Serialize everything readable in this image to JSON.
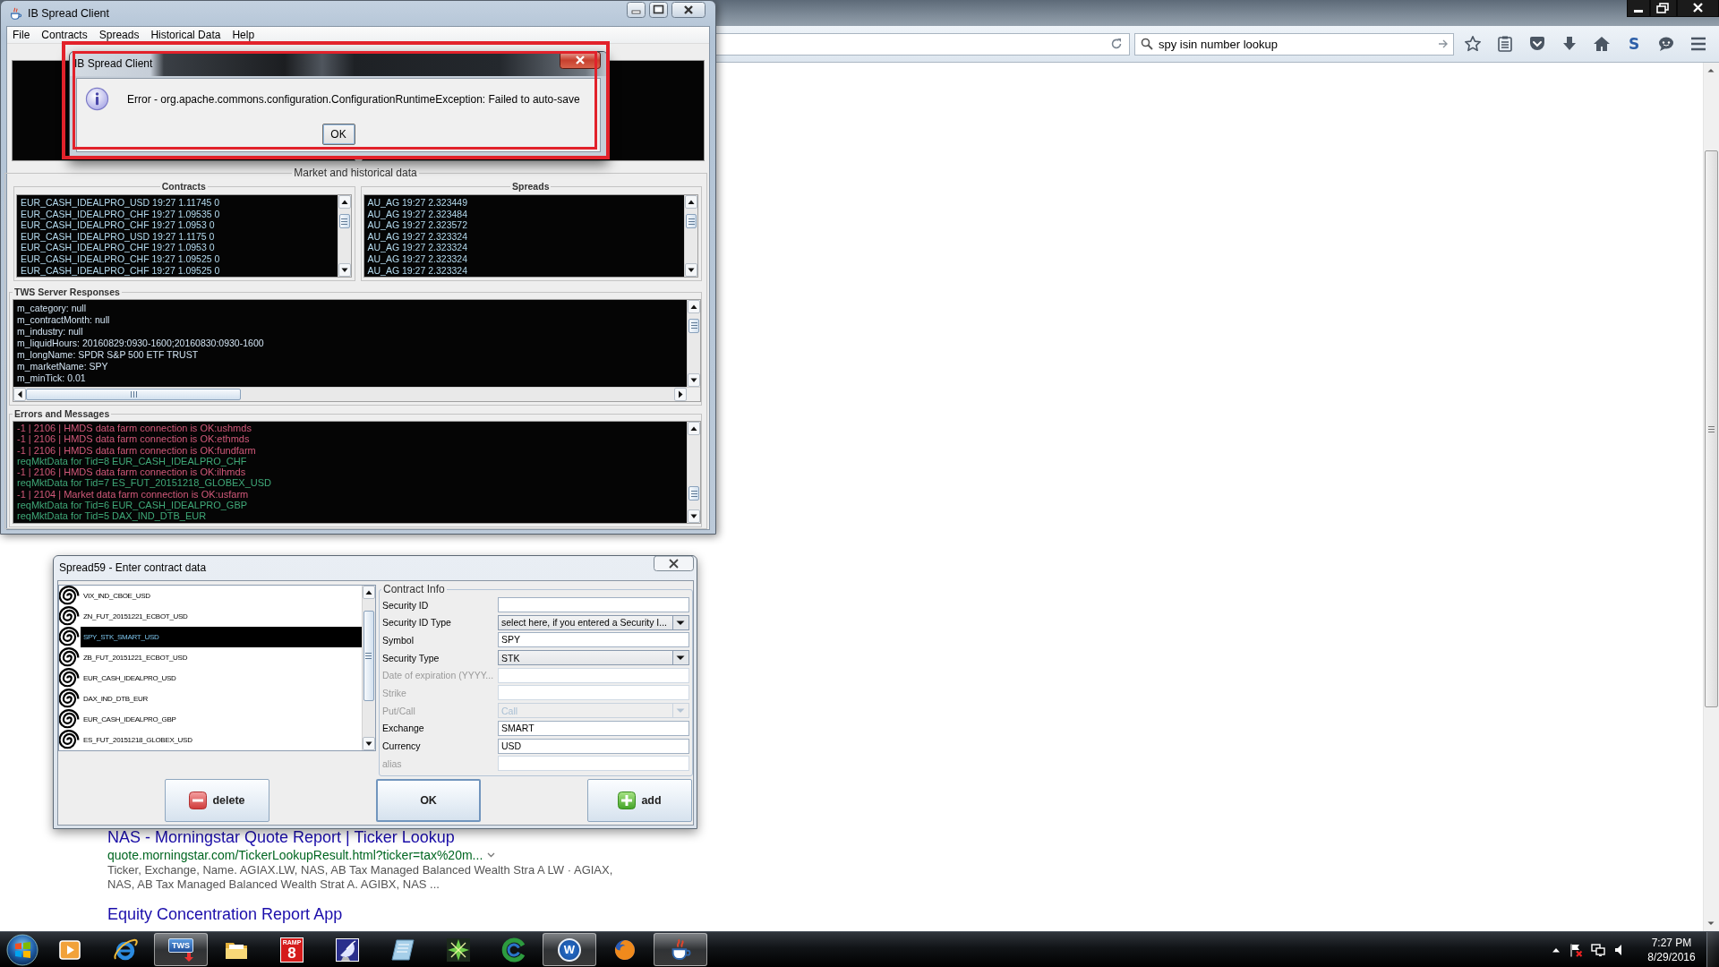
{
  "browser": {
    "search_field": {
      "value": "spy isin number lookup"
    },
    "logo_button": "S",
    "results": [
      {
        "title": "NAS - Morningstar Quote Report | Ticker Lookup",
        "url": "quote.morningstar.com/TickerLookupResult.html?ticker=tax%20m...",
        "snippet": "Ticker, Exchange, Name. AGIAX.LW, NAS, AB Tax Managed Balanced Wealth Stra A LW · AGIAX, NAS, AB Tax Managed Balanced Wealth Strat A. AGIBX, NAS ..."
      },
      {
        "title": "Equity Concentration Report App"
      }
    ]
  },
  "main_window": {
    "title": "IB Spread Client",
    "menu": [
      "File",
      "Contracts",
      "Spreads",
      "Historical Data",
      "Help"
    ],
    "market_panel": {
      "title": "Market and historical data",
      "contracts": {
        "title": "Contracts",
        "lines": [
          "EUR_CASH_IDEALPRO_USD 19:27 1.11745 0",
          "EUR_CASH_IDEALPRO_CHF 19:27 1.09535 0",
          "EUR_CASH_IDEALPRO_CHF 19:27 1.0953 0",
          "EUR_CASH_IDEALPRO_USD 19:27 1.1175 0",
          "EUR_CASH_IDEALPRO_CHF 19:27 1.0953 0",
          "EUR_CASH_IDEALPRO_CHF 19:27 1.09525 0",
          "EUR_CASH_IDEALPRO_CHF 19:27 1.09525 0"
        ]
      },
      "spreads": {
        "title": "Spreads",
        "lines": [
          "AU_AG 19:27 2.323449",
          "AU_AG 19:27 2.323484",
          "AU_AG 19:27 2.323572",
          "AU_AG 19:27 2.323324",
          "AU_AG 19:27 2.323324",
          "AU_AG 19:27 2.323324",
          "AU_AG 19:27 2.323324"
        ]
      },
      "tws_responses": {
        "title": "TWS Server Responses",
        "lines": [
          "m_category: null",
          "m_contractMonth: null",
          "m_industry: null",
          "m_liquidHours: 20160829:0930-1600;20160830:0930-1600",
          "m_longName: SPDR S&P 500 ETF TRUST",
          "m_marketName: SPY",
          "m_minTick: 0.01"
        ]
      },
      "errors_and_messages": {
        "title": "Errors and Messages",
        "lines": [
          {
            "text": "-1 | 2106 | HMDS data farm connection is OK:ushmds",
            "color": "#d2597a"
          },
          {
            "text": "-1 | 2106 | HMDS data farm connection is OK:ethmds",
            "color": "#d2597a"
          },
          {
            "text": "-1 | 2106 | HMDS data farm connection is OK:fundfarm",
            "color": "#d2597a"
          },
          {
            "text": "reqMktData for Tid=8 EUR_CASH_IDEALPRO_CHF",
            "color": "#3fa878"
          },
          {
            "text": "-1 | 2106 | HMDS data farm connection is OK:ilhmds",
            "color": "#d2597a"
          },
          {
            "text": "reqMktData for Tid=7 ES_FUT_20151218_GLOBEX_USD",
            "color": "#3fa878"
          },
          {
            "text": "-1 | 2104 | Market data farm connection is OK:usfarm",
            "color": "#d2597a"
          },
          {
            "text": "reqMktData for Tid=6 EUR_CASH_IDEALPRO_GBP",
            "color": "#3fa878"
          },
          {
            "text": "reqMktData for Tid=5 DAX_IND_DTB_EUR",
            "color": "#3fa878"
          }
        ]
      }
    }
  },
  "alert_dialog": {
    "title": "IB Spread Client",
    "message": "Error - org.apache.commons.configuration.ConfigurationRuntimeException: Failed to auto-save",
    "button": "OK"
  },
  "contract_dialog": {
    "title": "Spread59 - Enter contract data",
    "contracts": [
      {
        "name": "VIX_IND_CBOE_USD",
        "selected": false
      },
      {
        "name": "ZN_FUT_20151221_ECBOT_USD",
        "selected": false
      },
      {
        "name": "SPY_STK_SMART_USD",
        "selected": true
      },
      {
        "name": "ZB_FUT_20151221_ECBOT_USD",
        "selected": false
      },
      {
        "name": "EUR_CASH_IDEALPRO_USD",
        "selected": false
      },
      {
        "name": "DAX_IND_DTB_EUR",
        "selected": false
      },
      {
        "name": "EUR_CASH_IDEALPRO_GBP",
        "selected": false
      },
      {
        "name": "ES_FUT_20151218_GLOBEX_USD",
        "selected": false
      }
    ],
    "contract_info": {
      "title": "Contract Info",
      "fields": [
        {
          "label": "Security ID",
          "kind": "text",
          "disabled": false
        },
        {
          "label": "Security ID Type",
          "kind": "select",
          "value": "select here, if you entered a Security I...",
          "disabled": false
        },
        {
          "label": "Symbol",
          "kind": "text",
          "value": "SPY",
          "disabled": false
        },
        {
          "label": "Security Type",
          "kind": "select",
          "value": "STK",
          "disabled": false
        },
        {
          "label": "Date of expiration (YYYY...",
          "kind": "text",
          "disabled": true
        },
        {
          "label": "Strike",
          "kind": "text",
          "disabled": true
        },
        {
          "label": "Put/Call",
          "kind": "select",
          "value": "Call",
          "disabled": true
        },
        {
          "label": "Exchange",
          "kind": "text",
          "value": "SMART",
          "disabled": false
        },
        {
          "label": "Currency",
          "kind": "text",
          "value": "USD",
          "disabled": false
        },
        {
          "label": "alias",
          "kind": "text",
          "disabled": true
        }
      ]
    },
    "buttons": [
      {
        "label": "delete",
        "kind": "delete"
      },
      {
        "label": "OK",
        "kind": "default"
      },
      {
        "label": "add",
        "kind": "add"
      }
    ]
  },
  "taskbar": {
    "apps": [
      {
        "kind": "play",
        "active": false
      },
      {
        "kind": "e-ring",
        "active": false
      },
      {
        "kind": "tws",
        "label": "TWS",
        "active": true
      },
      {
        "kind": "folder",
        "active": false
      },
      {
        "kind": "ramp",
        "label": "RAMP",
        "badge": "8",
        "active": false
      },
      {
        "kind": "dish",
        "active": false
      },
      {
        "kind": "book",
        "active": false
      },
      {
        "kind": "star",
        "active": false
      },
      {
        "kind": "swirl",
        "active": false
      },
      {
        "kind": "w",
        "label": "W",
        "active": true
      },
      {
        "kind": "globe",
        "active": false
      },
      {
        "kind": "cup",
        "active": true
      }
    ],
    "clock": {
      "time": "7:27 PM",
      "date": "8/29/2016"
    }
  }
}
